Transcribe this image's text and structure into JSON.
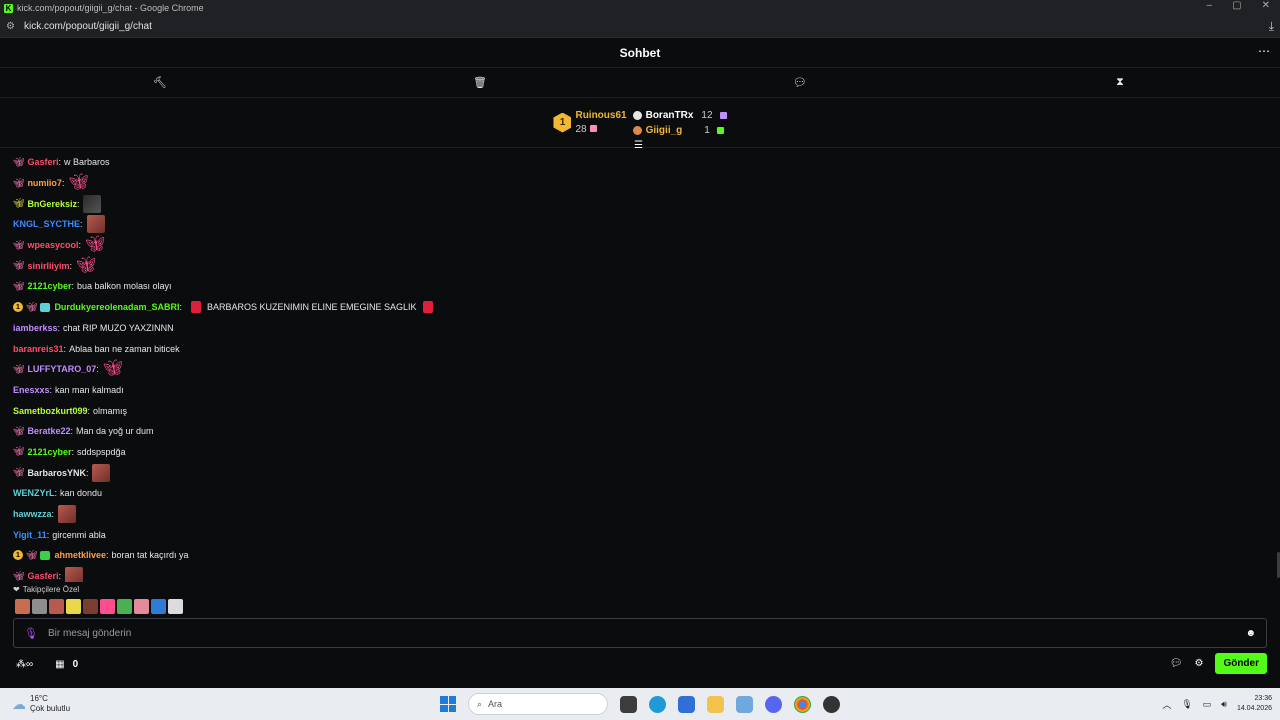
{
  "browser": {
    "title": "kick.com/popout/giigii_g/chat - Google Chrome",
    "url": "kick.com/popout/giigii_g/chat"
  },
  "chat": {
    "title": "Sohbet",
    "leaderboard": {
      "first": {
        "rank": "1",
        "name": "Ruinous61",
        "count": "28"
      },
      "others": [
        {
          "name": "BoranTRx",
          "count": "12"
        },
        {
          "name": "Giigii_g",
          "count": "1"
        }
      ]
    },
    "messages": [
      {
        "badges": [
          "bf"
        ],
        "user": "Gasferi",
        "color": "#ff4d6a",
        "text": "w Barbaros",
        "emotes": []
      },
      {
        "badges": [
          "bf"
        ],
        "user": "numiio7",
        "color": "#ff9f43",
        "text": "",
        "emotes": [
          "bf"
        ]
      },
      {
        "badges": [
          "bf-y"
        ],
        "user": "BnGereksiz",
        "color": "#b6ff3b",
        "text": "",
        "emotes": [
          "dark"
        ]
      },
      {
        "badges": [],
        "user": "KNGL_SYCTHE",
        "color": "#3a8dff",
        "text": "",
        "emotes": [
          "face"
        ]
      },
      {
        "badges": [
          "bf"
        ],
        "user": "wpeasycool",
        "color": "#ff4d6a",
        "text": "",
        "emotes": [
          "bf"
        ]
      },
      {
        "badges": [
          "bf"
        ],
        "user": "sinirliiyim",
        "color": "#ff4d6a",
        "text": "",
        "emotes": [
          "bf"
        ]
      },
      {
        "badges": [
          "bf"
        ],
        "user": "2121cyber",
        "color": "#53fc18",
        "text": "bua balkon molası olayı",
        "emotes": []
      },
      {
        "badges": [
          "sub",
          "bf",
          "box"
        ],
        "user": "Durdukyereolenadam_SABRI",
        "color": "#53fc18",
        "text": "BARBAROS KUZENIMIN ELINE EMEGINE SAGLIK",
        "emotes": [],
        "flags": true
      },
      {
        "badges": [],
        "user": "iamberkss",
        "color": "#c38cff",
        "text": "chat RIP MUZO YAXZINNN",
        "emotes": []
      },
      {
        "badges": [],
        "user": "baranreis31",
        "color": "#ff4d6a",
        "text": "Ablaa ban ne zaman biticek",
        "emotes": []
      },
      {
        "badges": [
          "bf"
        ],
        "user": "LUFFYTARO_07",
        "color": "#c38cff",
        "text": "",
        "emotes": [
          "bf"
        ]
      },
      {
        "badges": [],
        "user": "Enesxxs",
        "color": "#c38cff",
        "text": "kan man kalmadı",
        "emotes": []
      },
      {
        "badges": [],
        "user": "Sametbozkurt099",
        "color": "#b6ff3b",
        "text": "olmamış",
        "emotes": []
      },
      {
        "badges": [
          "bf"
        ],
        "user": "Beratke22",
        "color": "#c38cff",
        "text": "Man da yoğ ur dum",
        "emotes": []
      },
      {
        "badges": [
          "bf"
        ],
        "user": "2121cyber",
        "color": "#53fc18",
        "text": "sddspspdğa",
        "emotes": []
      },
      {
        "badges": [
          "bf"
        ],
        "user": "BarbarosYNK",
        "color": "#e6e6e6",
        "text": "",
        "emotes": [
          "face"
        ]
      },
      {
        "badges": [],
        "user": "WENZYrL",
        "color": "#5ed1d6",
        "text": "kan dondu",
        "emotes": []
      },
      {
        "badges": [],
        "user": "hawwzza",
        "color": "#5ed1d6",
        "text": "",
        "emotes": [
          "face"
        ]
      },
      {
        "badges": [],
        "user": "Yigit_11",
        "color": "#3a8dff",
        "text": "gircenmi abla",
        "emotes": []
      },
      {
        "badges": [
          "sub",
          "bf",
          "gift"
        ],
        "user": "ahmetklivee",
        "color": "#ff9f43",
        "text": "boran tat kaçırdı ya",
        "emotes": []
      },
      {
        "badges": [
          "bf"
        ],
        "user": "Gasferi",
        "color": "#ff4d6a",
        "text": "",
        "emotes": [
          "face"
        ]
      }
    ],
    "followers_label": "Takipçilere Özel",
    "input_placeholder": "Bir mesaj gönderin",
    "bottom_count": "0",
    "send_label": "Gönder"
  },
  "taskbar": {
    "temp": "16°C",
    "weather": "Çok bulutlu",
    "search": "Ara",
    "time": "23:36",
    "date": "14.04.2026"
  }
}
